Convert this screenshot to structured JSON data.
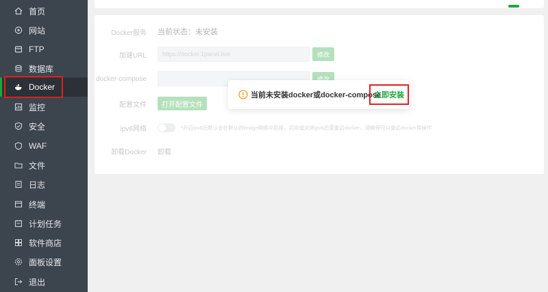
{
  "sidebar": {
    "items": [
      {
        "label": "首页",
        "icon": "home-icon"
      },
      {
        "label": "网站",
        "icon": "globe-icon"
      },
      {
        "label": "FTP",
        "icon": "ftp-icon"
      },
      {
        "label": "数据库",
        "icon": "database-icon"
      },
      {
        "label": "Docker",
        "icon": "docker-icon"
      },
      {
        "label": "监控",
        "icon": "monitor-icon"
      },
      {
        "label": "安全",
        "icon": "shield-icon"
      },
      {
        "label": "WAF",
        "icon": "waf-icon"
      },
      {
        "label": "文件",
        "icon": "folder-icon"
      },
      {
        "label": "日志",
        "icon": "log-icon"
      },
      {
        "label": "终端",
        "icon": "terminal-icon"
      },
      {
        "label": "计划任务",
        "icon": "schedule-icon"
      },
      {
        "label": "软件商店",
        "icon": "store-icon"
      },
      {
        "label": "面板设置",
        "icon": "settings-icon"
      },
      {
        "label": "退出",
        "icon": "logout-icon"
      }
    ],
    "active": "Docker"
  },
  "docker_settings": {
    "service": {
      "label": "Docker服务",
      "status": "当前状态：未安装"
    },
    "mirror": {
      "label": "加速URL",
      "placeholder": "https://docker.1panel.live",
      "button": "修改"
    },
    "compose": {
      "label": "docker-compose",
      "button": "修改"
    },
    "config": {
      "label": "配置文件",
      "button": "打开配置文件"
    },
    "ipv6": {
      "label": "ipv6网络",
      "hint": "*开启ipv6后默认会在默认的bridge网络中启用，启用或关闭ipv6后需重启docker，请确保可以重启docker再操作"
    },
    "uninstall": {
      "label": "卸载Docker",
      "link": "卸载"
    }
  },
  "popup": {
    "message": "当前未安装docker或docker-compose",
    "install_button": "立即安装"
  },
  "colors": {
    "accent": "#20a53a",
    "highlight": "#e02020",
    "sidebar": "#3c444d"
  }
}
